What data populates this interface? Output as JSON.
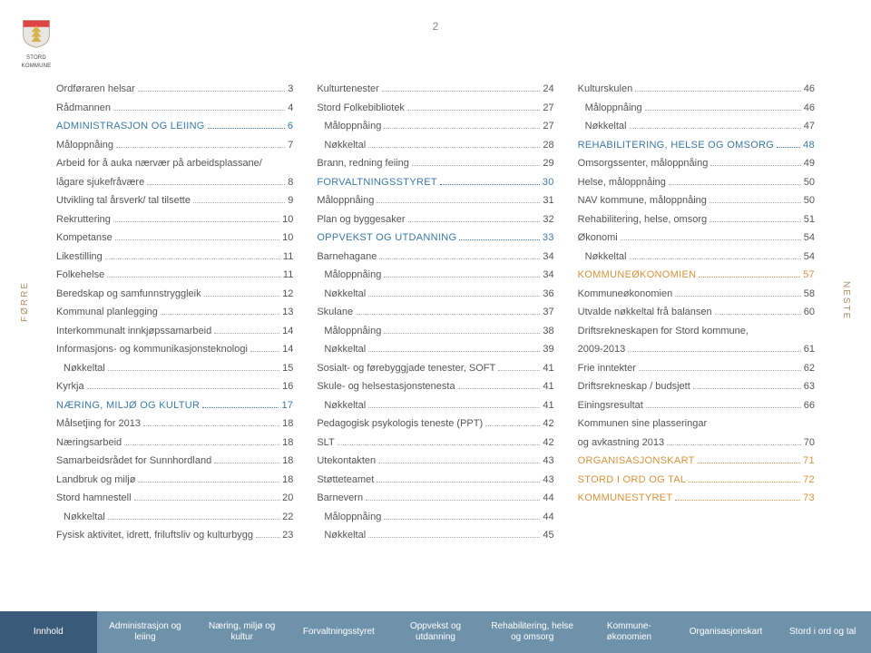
{
  "page_number": "2",
  "logo_text_1": "STORD",
  "logo_text_2": "KOMMUNE",
  "side_prev": "FØRRE",
  "side_next": "NESTE",
  "columns": [
    [
      {
        "label": "Ordføraren helsar",
        "page": "3"
      },
      {
        "label": "Rådmannen",
        "page": "4"
      },
      {
        "label": "ADMINISTRASJON OG LEIING",
        "page": "6",
        "caps": true,
        "color": "blue"
      },
      {
        "label": "Måloppnåing",
        "page": "7"
      },
      {
        "label": "Arbeid for å auka nærvær på arbeidsplassane/",
        "no_page": true
      },
      {
        "label": "lågare sjukefråvære",
        "page": "8"
      },
      {
        "label": "Utvikling tal årsverk/ tal tilsette",
        "page": "9"
      },
      {
        "label": "Rekruttering",
        "page": "10"
      },
      {
        "label": "Kompetanse",
        "page": "10"
      },
      {
        "label": "Likestilling",
        "page": "11"
      },
      {
        "label": "Folkehelse",
        "page": "11"
      },
      {
        "label": "Beredskap og samfunnstryggleik",
        "page": "12"
      },
      {
        "label": "Kommunal planlegging",
        "page": "13"
      },
      {
        "label": "Interkommunalt innkjøpssamarbeid",
        "page": "14"
      },
      {
        "label": "Informasjons- og kommunikasjonsteknologi",
        "page": "14"
      },
      {
        "label": "Nøkkeltal",
        "page": "15",
        "indent": true
      },
      {
        "label": "Kyrkja",
        "page": "16"
      },
      {
        "label": "NÆRING, MILJØ OG KULTUR",
        "page": "17",
        "caps": true,
        "color": "blue"
      },
      {
        "label": "Målsetjing for 2013",
        "page": "18"
      },
      {
        "label": "Næringsarbeid",
        "page": "18"
      },
      {
        "label": "Samarbeidsrådet for Sunnhordland",
        "page": "18"
      },
      {
        "label": "Landbruk og miljø",
        "page": "18"
      },
      {
        "label": "Stord hamnestell",
        "page": "20"
      },
      {
        "label": "Nøkkeltal",
        "page": "22",
        "indent": true
      },
      {
        "label": "Fysisk aktivitet, idrett, friluftsliv og kulturbygg",
        "page": "23"
      }
    ],
    [
      {
        "label": "Kulturtenester",
        "page": "24"
      },
      {
        "label": "Stord Folkebibliotek",
        "page": "27"
      },
      {
        "label": "Måloppnåing",
        "page": "27",
        "indent": true
      },
      {
        "label": "Nøkkeltal",
        "page": "28",
        "indent": true
      },
      {
        "label": "Brann, redning feiing",
        "page": "29"
      },
      {
        "label": "FORVALTNINGSSTYRET",
        "page": "30",
        "caps": true,
        "color": "blue"
      },
      {
        "label": "Måloppnåing",
        "page": "31"
      },
      {
        "label": "Plan og byggesaker",
        "page": "32"
      },
      {
        "label": "OPPVEKST OG UTDANNING",
        "page": "33",
        "caps": true,
        "color": "blue"
      },
      {
        "label": "Barnehagane",
        "page": "34"
      },
      {
        "label": "Måloppnåing",
        "page": "34",
        "indent": true
      },
      {
        "label": "Nøkkeltal",
        "page": "36",
        "indent": true
      },
      {
        "label": "Skulane",
        "page": "37"
      },
      {
        "label": "Måloppnåing",
        "page": "38",
        "indent": true
      },
      {
        "label": "Nøkkeltal",
        "page": "39",
        "indent": true
      },
      {
        "label": "Sosialt- og førebyggjade tenester, SOFT",
        "page": "41"
      },
      {
        "label": "Skule- og helsestasjonstenesta",
        "page": "41"
      },
      {
        "label": "Nøkkeltal",
        "page": "41",
        "indent": true
      },
      {
        "label": "Pedagogisk psykologis teneste (PPT)",
        "page": "42"
      },
      {
        "label": "SLT",
        "page": "42"
      },
      {
        "label": "Utekontakten",
        "page": "43"
      },
      {
        "label": "Støtteteamet",
        "page": "43"
      },
      {
        "label": "Barnevern",
        "page": "44"
      },
      {
        "label": "Måloppnåing",
        "page": "44",
        "indent": true
      },
      {
        "label": "Nøkkeltal",
        "page": "45",
        "indent": true
      }
    ],
    [
      {
        "label": "Kulturskulen",
        "page": "46"
      },
      {
        "label": "Måloppnåing",
        "page": "46",
        "indent": true
      },
      {
        "label": "Nøkkeltal",
        "page": "47",
        "indent": true
      },
      {
        "label": "REHABILITERING, HELSE OG OMSORG",
        "page": "48",
        "caps": true,
        "color": "blue"
      },
      {
        "label": "Omsorgssenter, måloppnåing",
        "page": "49"
      },
      {
        "label": "Helse, måloppnåing",
        "page": "50"
      },
      {
        "label": "NAV kommune, måloppnåing",
        "page": "50"
      },
      {
        "label": "Rehabilitering, helse, omsorg",
        "page": "51"
      },
      {
        "label": "Økonomi",
        "page": "54"
      },
      {
        "label": "Nøkkeltal",
        "page": "54",
        "indent": true
      },
      {
        "label": "KOMMUNEØKONOMIEN",
        "page": "57",
        "caps": true,
        "color": "orange"
      },
      {
        "label": "Kommuneøkonomien",
        "page": "58"
      },
      {
        "label": "Utvalde nøkkeltal frå balansen",
        "page": "60"
      },
      {
        "label": "Driftsrekneskapen for Stord kommune,",
        "no_page": true
      },
      {
        "label": "2009-2013",
        "page": "61"
      },
      {
        "label": "Frie inntekter",
        "page": "62"
      },
      {
        "label": "Driftsrekneskap / budsjett",
        "page": "63"
      },
      {
        "label": "Einingsresultat",
        "page": "66"
      },
      {
        "label": "Kommunen sine plasseringar",
        "no_page": true
      },
      {
        "label": "og avkastning 2013",
        "page": "70"
      },
      {
        "label": "ORGANISASJONSKART",
        "page": "71",
        "caps": true,
        "color": "orange"
      },
      {
        "label": "STORD I ORD OG TAL",
        "page": "72",
        "caps": true,
        "color": "orange"
      },
      {
        "label": "KOMMUNESTYRET",
        "page": "73",
        "caps": true,
        "color": "orange"
      }
    ]
  ],
  "nav": [
    "Innhold",
    "Administrasjon og leiing",
    "Næring, miljø og kultur",
    "Forvaltningsstyret",
    "Oppvekst og utdanning",
    "Rehabilitering, helse og omsorg",
    "Kommune- økonomien",
    "Organisasjonskart",
    "Stord i ord og tal"
  ]
}
